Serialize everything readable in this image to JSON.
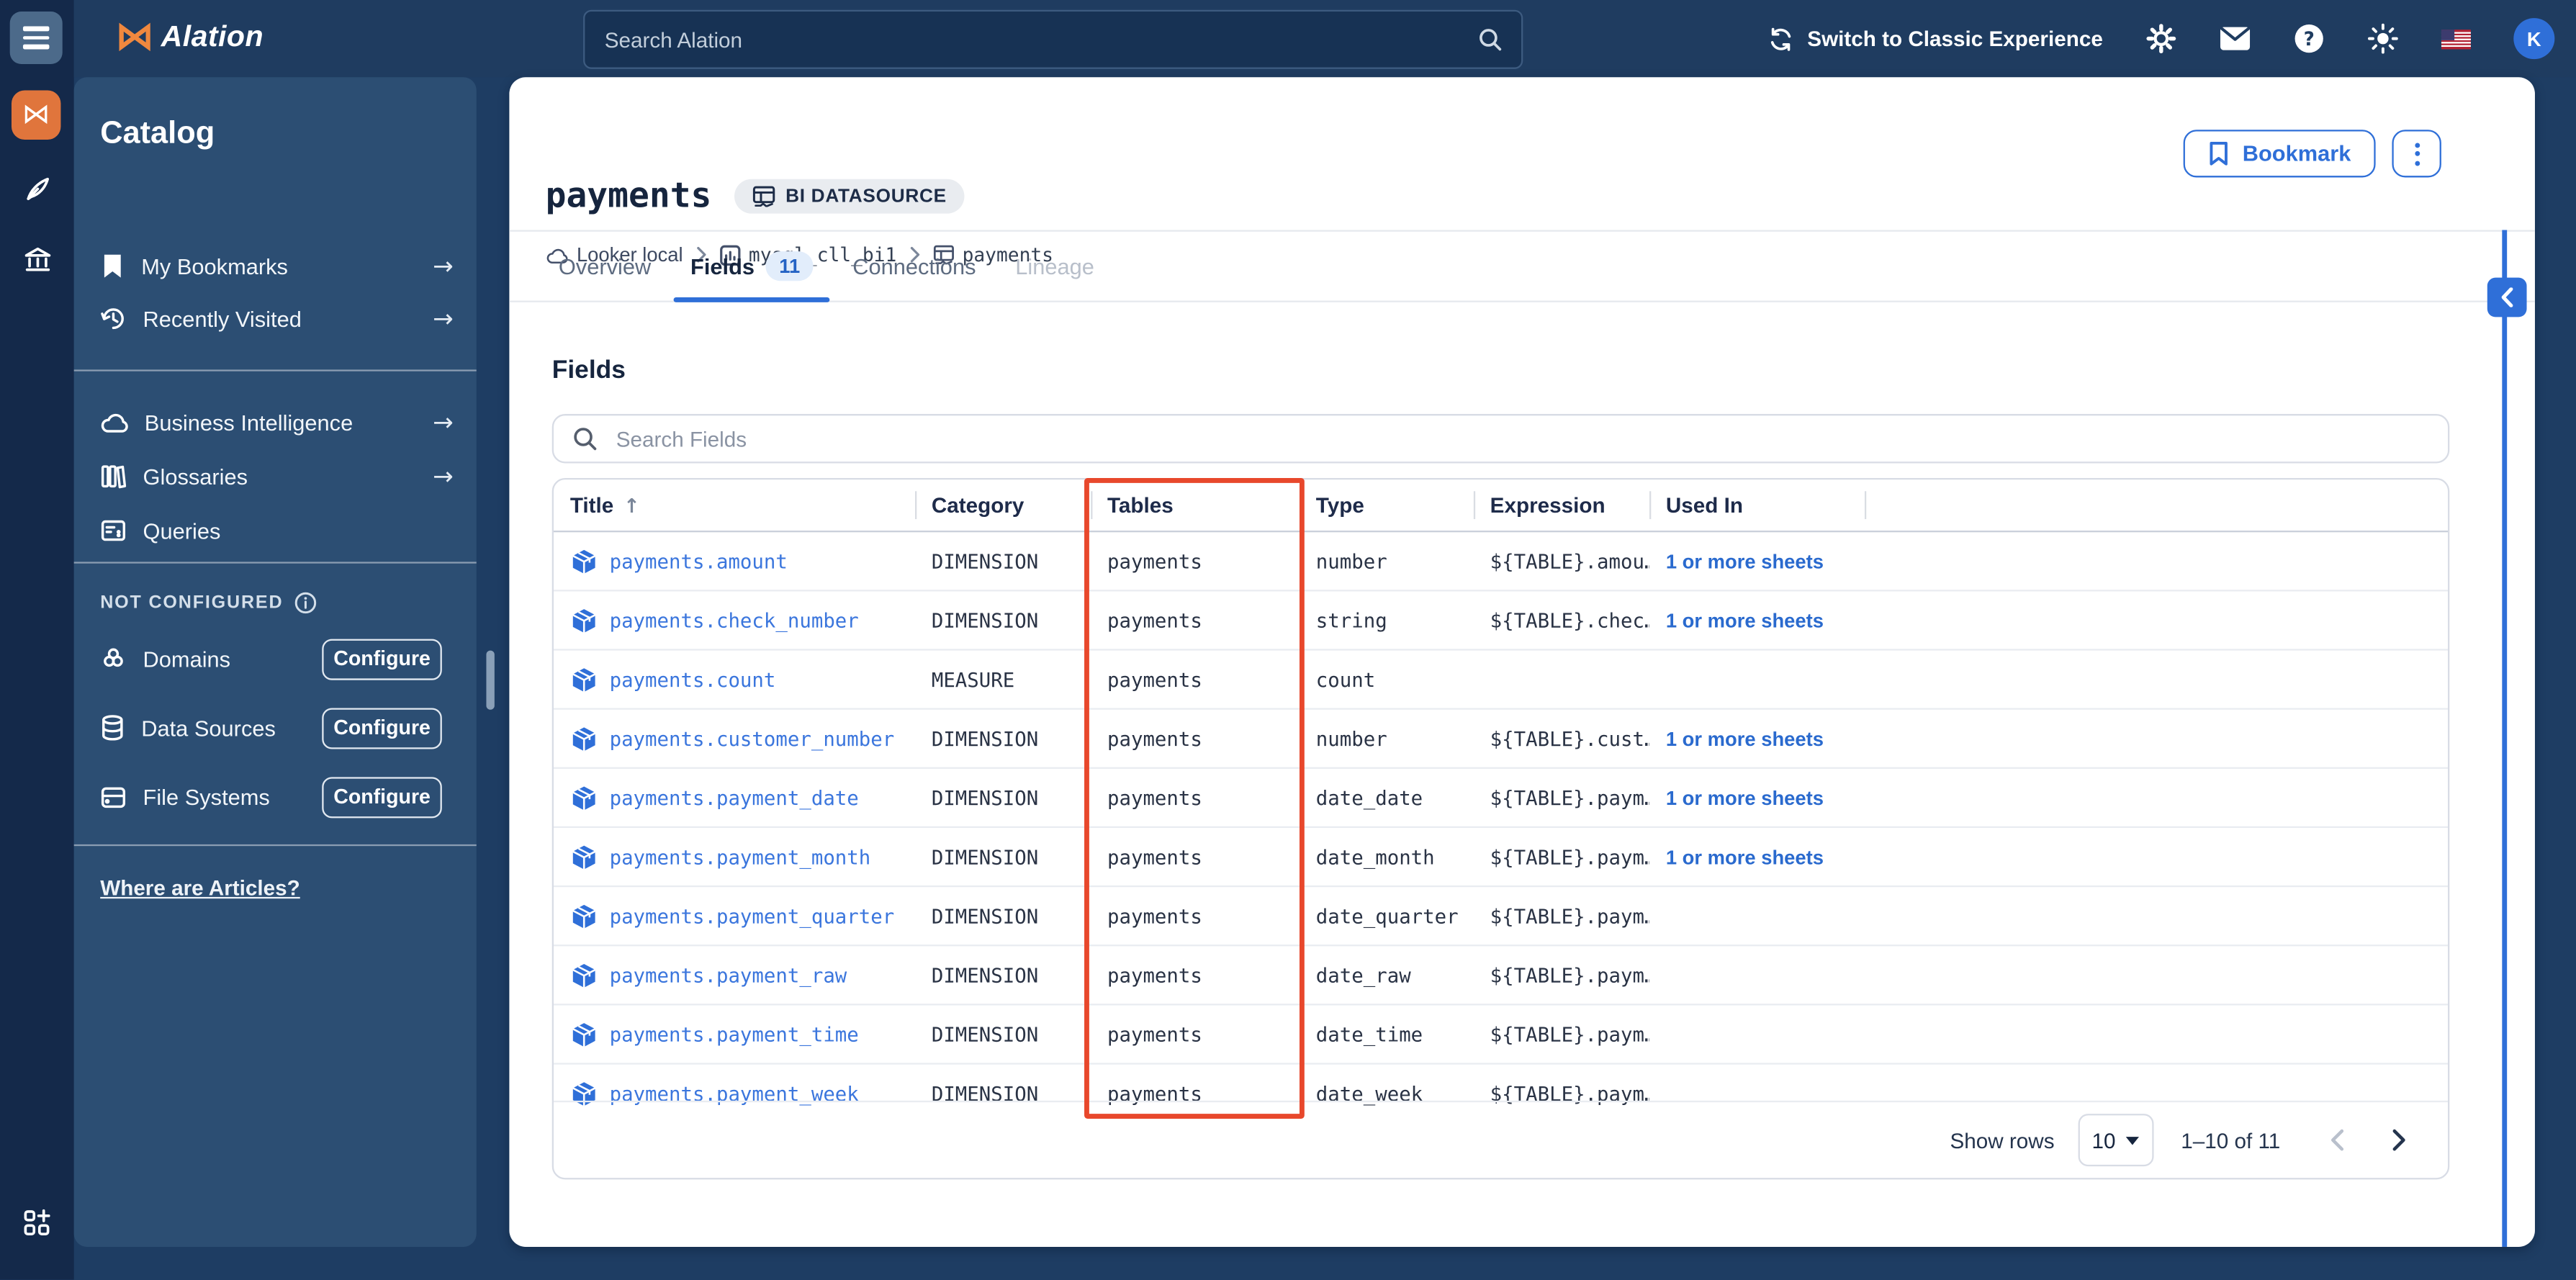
{
  "colors": {
    "accent_blue": "#2f6fd8",
    "highlight_red": "#e8482c",
    "brand_orange": "#e0753c",
    "navy_background": "#1e3d63",
    "panel_blue": "#2c4e73"
  },
  "topbar": {
    "brand": "Alation",
    "search_placeholder": "Search Alation",
    "switch_label": "Switch to Classic Experience",
    "avatar_initial": "K",
    "icons": [
      "refresh-icon",
      "gear-icon",
      "mail-icon",
      "help-icon",
      "sun-icon",
      "us-flag-icon"
    ]
  },
  "sidebar": {
    "title": "Catalog",
    "nav_items": [
      {
        "label": "My Bookmarks",
        "icon": "bookmark-icon",
        "arrow": "→"
      },
      {
        "label": "Recently Visited",
        "icon": "history-icon",
        "arrow": "→"
      }
    ],
    "catalog_items": [
      {
        "label": "Business Intelligence",
        "icon": "cloud-icon",
        "arrow": "→"
      },
      {
        "label": "Glossaries",
        "icon": "glossary-icon",
        "arrow": "→"
      },
      {
        "label": "Queries",
        "icon": "queries-icon",
        "arrow": ""
      }
    ],
    "not_configured": {
      "label": "NOT CONFIGURED",
      "items": [
        {
          "label": "Domains",
          "icon": "domains-icon",
          "action": "Configure"
        },
        {
          "label": "Data Sources",
          "icon": "database-icon",
          "action": "Configure"
        },
        {
          "label": "File Systems",
          "icon": "drive-icon",
          "action": "Configure"
        }
      ]
    },
    "footer_link": "Where are Articles?"
  },
  "page": {
    "title": "payments",
    "badge": "BI DATASOURCE",
    "breadcrumbs": [
      {
        "label": "Looker local",
        "icon": "cloud-icon"
      },
      {
        "label": "mysql_cll_bi1",
        "icon": "report-icon"
      },
      {
        "label": "payments",
        "icon": "table-icon"
      }
    ],
    "bookmark_label": "Bookmark",
    "tabs": [
      {
        "label": "Overview",
        "state": "normal"
      },
      {
        "label": "Fields",
        "count": "11",
        "state": "active"
      },
      {
        "label": "Connections",
        "state": "normal"
      },
      {
        "label": "Lineage",
        "state": "disabled"
      }
    ]
  },
  "fields_section": {
    "heading": "Fields",
    "search_placeholder": "Search Fields",
    "table": {
      "columns": [
        "Title",
        "Category",
        "Tables",
        "Type",
        "Expression",
        "Used In"
      ],
      "sorted_column": "Title",
      "highlighted_column": "Tables",
      "rows": [
        {
          "title": "payments.amount",
          "category": "DIMENSION",
          "tables": "payments",
          "type": "number",
          "expression": "${TABLE}.amou…",
          "used_in": "1 or more sheets"
        },
        {
          "title": "payments.check_number",
          "category": "DIMENSION",
          "tables": "payments",
          "type": "string",
          "expression": "${TABLE}.chec…",
          "used_in": "1 or more sheets"
        },
        {
          "title": "payments.count",
          "category": "MEASURE",
          "tables": "payments",
          "type": "count",
          "expression": "",
          "used_in": ""
        },
        {
          "title": "payments.customer_number",
          "category": "DIMENSION",
          "tables": "payments",
          "type": "number",
          "expression": "${TABLE}.cust…",
          "used_in": "1 or more sheets"
        },
        {
          "title": "payments.payment_date",
          "category": "DIMENSION",
          "tables": "payments",
          "type": "date_date",
          "expression": "${TABLE}.paym…",
          "used_in": "1 or more sheets"
        },
        {
          "title": "payments.payment_month",
          "category": "DIMENSION",
          "tables": "payments",
          "type": "date_month",
          "expression": "${TABLE}.paym…",
          "used_in": "1 or more sheets"
        },
        {
          "title": "payments.payment_quarter",
          "category": "DIMENSION",
          "tables": "payments",
          "type": "date_quarter",
          "expression": "${TABLE}.paym…",
          "used_in": ""
        },
        {
          "title": "payments.payment_raw",
          "category": "DIMENSION",
          "tables": "payments",
          "type": "date_raw",
          "expression": "${TABLE}.paym…",
          "used_in": ""
        },
        {
          "title": "payments.payment_time",
          "category": "DIMENSION",
          "tables": "payments",
          "type": "date_time",
          "expression": "${TABLE}.paym…",
          "used_in": ""
        },
        {
          "title": "payments.payment_week",
          "category": "DIMENSION",
          "tables": "payments",
          "type": "date_week",
          "expression": "${TABLE}.paym…",
          "used_in": ""
        }
      ]
    },
    "pagination": {
      "show_rows_label": "Show rows",
      "page_size": "10",
      "range": "1–10 of 11",
      "prev_enabled": false,
      "next_enabled": true
    }
  }
}
